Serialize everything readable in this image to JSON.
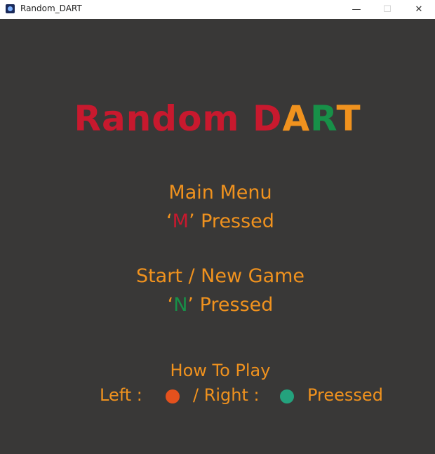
{
  "window": {
    "title": "Random_DART",
    "min_glyph": "—",
    "max_glyph": "☐",
    "close_glyph": "✕"
  },
  "colors": {
    "background": "#393837",
    "red": "#c8192e",
    "green": "#179048",
    "orange": "#f0921e",
    "left_dot": "#e4511d",
    "right_dot": "#24a27d"
  },
  "title": {
    "part1": "Random",
    "d": "D",
    "a": "A",
    "r": "R",
    "t": "T"
  },
  "menu": {
    "main_label": "Main Menu",
    "main_open_quote": "‘",
    "main_key": "M",
    "main_close_quote": "’",
    "main_pressed": "Pressed",
    "start_label": "Start / New Game",
    "start_open_quote": "‘",
    "start_key": "N",
    "start_close_quote": "’",
    "start_pressed": "Pressed",
    "howto_label": "How To Play",
    "left_text": "Left :",
    "right_text": "/ Right :",
    "pressed_text": "Preessed"
  }
}
